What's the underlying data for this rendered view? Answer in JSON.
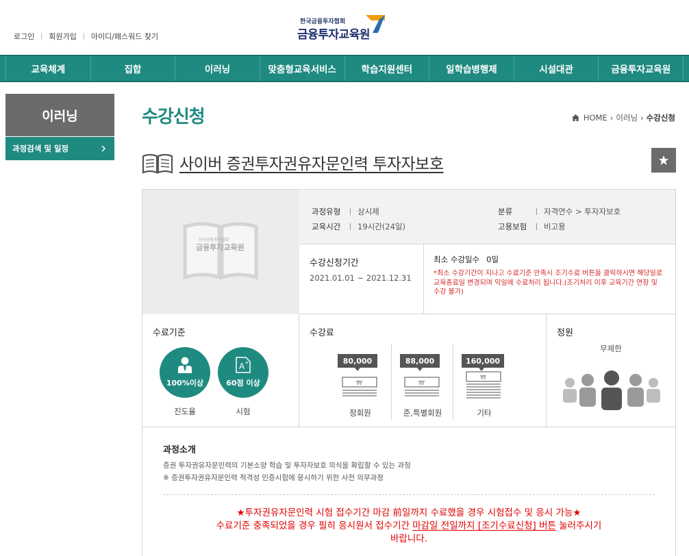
{
  "header": {
    "links": [
      "로그인",
      "회원가입",
      "아이디/패스워드 찾기"
    ],
    "logo": {
      "small": "한국금융투자협회",
      "big": "금융투자교육원"
    }
  },
  "gnb": [
    "교육체계",
    "집합",
    "이러닝",
    "맞춤형교육서비스",
    "학습지원센터",
    "일학습병행제",
    "시설대관",
    "금융투자교육원"
  ],
  "lnb": {
    "title": "이러닝",
    "item": "과정검색 및 일정"
  },
  "page": {
    "title": "수강신청",
    "breadcrumb": {
      "home": "HOME",
      "mid": "이러닝",
      "current": "수강신청"
    }
  },
  "course": {
    "title": "사이버 증권투자권유자문인력 투자자보호",
    "thumb_logo_small": "한국금융투자협회",
    "thumb_logo_big": "금융투자교육원",
    "meta": {
      "type_label": "과정유형",
      "type_value": "상시제",
      "hours_label": "교육시간",
      "hours_value": "19시간(24일)",
      "category_label": "분류",
      "category_value": "자격연수 > 투자자보호",
      "insurance_label": "고용보험",
      "insurance_value": "비고용"
    },
    "period": {
      "label": "수강신청기간",
      "value": "2021.01.01 ~ 2021.12.31"
    },
    "min_days": {
      "label": "최소 수강일수",
      "value": "0일",
      "note": "*최소 수강기간이 지나고 수료기준 만족시 조기수료 버튼을 클릭하시면 해당일로 교육종료일 변경되며 익일에 수료처리 됩니다.(조기처리 이후 교육기간 연장 및 수강 불가)"
    },
    "completion": {
      "label": "수료기준",
      "items": [
        {
          "badge": "100%이상",
          "caption": "진도율"
        },
        {
          "badge": "60점 이상",
          "caption": "시험"
        }
      ]
    },
    "fee": {
      "label": "수강료",
      "items": [
        {
          "price": "80,000",
          "caption": "정회원"
        },
        {
          "price": "88,000",
          "caption": "준,특별회원"
        },
        {
          "price": "160,000",
          "caption": "기타"
        }
      ]
    },
    "capacity": {
      "label": "정원",
      "value": "무제한"
    },
    "intro": {
      "label": "과정소개",
      "line1": "증권 투자권유자문인력의 기본소양 학습 및 투자자보호 의식을 확립할 수 있는 과정",
      "line2": "※ 증권투자권유자문인력 적격성 인증시험에 응시하기 위한 사전 의무과정",
      "notice1": "★투자권유자문인력 시험 접수기간 마감 前일까지 수료했을 경우 시험접수 및 응시 가능★",
      "notice2a": "수료기준 충족되었을 경우 필히 응시원서 접수기간 ",
      "notice2b": "마감일 전일까지 [조기수료신청] 버튼",
      "notice2c": " 눌러주시기",
      "notice3": "바랍니다."
    }
  },
  "colors": {
    "primary": "#1f8a80",
    "gray": "#6b6b6b",
    "notice": "#e10000"
  }
}
